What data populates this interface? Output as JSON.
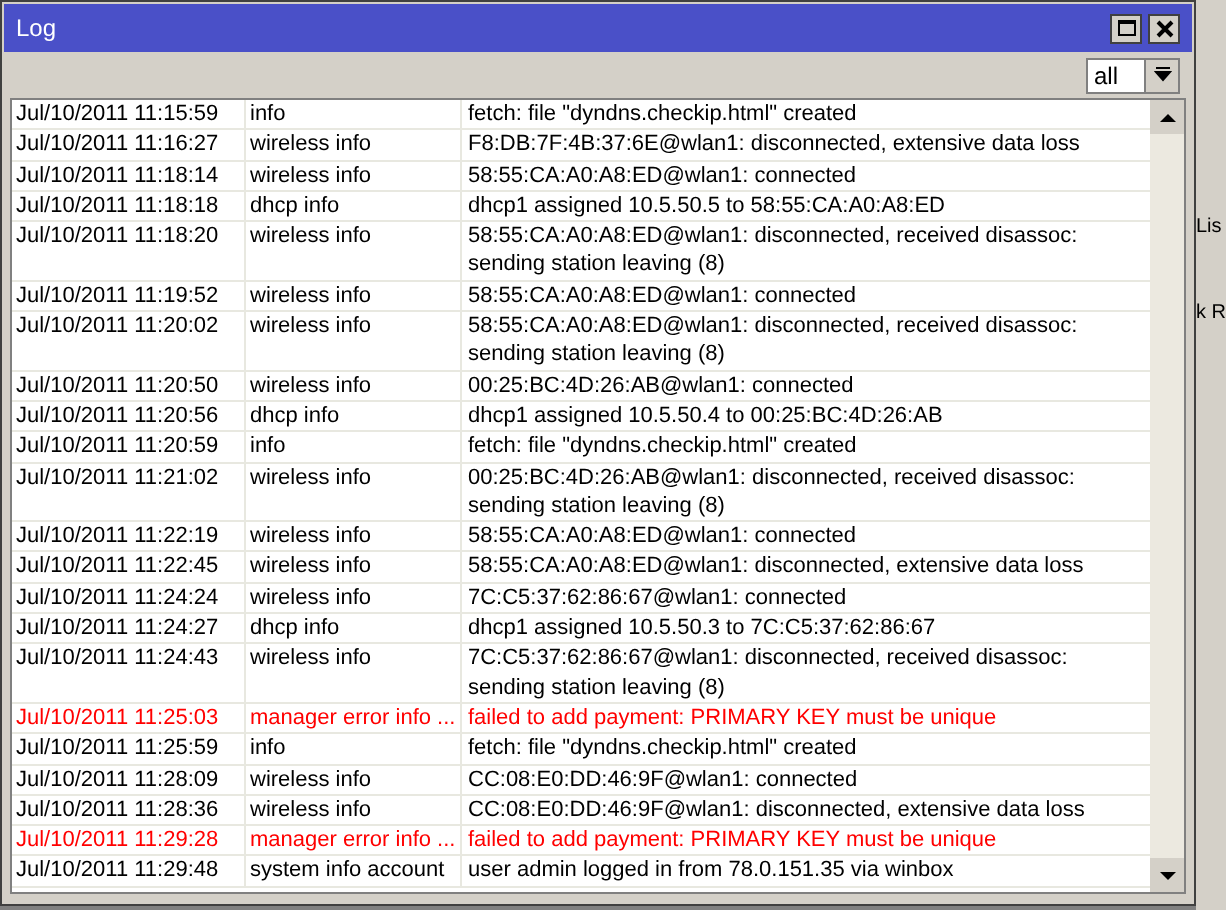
{
  "window": {
    "title": "Log"
  },
  "filter": {
    "value": "all"
  },
  "background_window": {
    "labels": [
      "Lis",
      "k R"
    ]
  },
  "rows": [
    {
      "time": "Jul/10/2011 11:15:59",
      "topics": "info",
      "message": "fetch: file \"dyndns.checkip.html\" created",
      "error": false
    },
    {
      "time": "Jul/10/2011 11:16:27",
      "topics": "wireless info",
      "message": "F8:DB:7F:4B:37:6E@wlan1: disconnected, extensive data loss",
      "error": false
    },
    {
      "time": "Jul/10/2011 11:18:14",
      "topics": "wireless info",
      "message": "58:55:CA:A0:A8:ED@wlan1: connected",
      "error": false
    },
    {
      "time": "Jul/10/2011 11:18:18",
      "topics": "dhcp info",
      "message": "dhcp1 assigned 10.5.50.5 to 58:55:CA:A0:A8:ED",
      "error": false
    },
    {
      "time": "Jul/10/2011 11:18:20",
      "topics": "wireless info",
      "message": "58:55:CA:A0:A8:ED@wlan1: disconnected, received disassoc: sending station leaving (8)",
      "error": false
    },
    {
      "time": "Jul/10/2011 11:19:52",
      "topics": "wireless info",
      "message": "58:55:CA:A0:A8:ED@wlan1: connected",
      "error": false
    },
    {
      "time": "Jul/10/2011 11:20:02",
      "topics": "wireless info",
      "message": "58:55:CA:A0:A8:ED@wlan1: disconnected, received disassoc: sending station leaving (8)",
      "error": false
    },
    {
      "time": "Jul/10/2011 11:20:50",
      "topics": "wireless info",
      "message": "00:25:BC:4D:26:AB@wlan1: connected",
      "error": false
    },
    {
      "time": "Jul/10/2011 11:20:56",
      "topics": "dhcp info",
      "message": "dhcp1 assigned 10.5.50.4 to 00:25:BC:4D:26:AB",
      "error": false
    },
    {
      "time": "Jul/10/2011 11:20:59",
      "topics": "info",
      "message": "fetch: file \"dyndns.checkip.html\" created",
      "error": false
    },
    {
      "time": "Jul/10/2011 11:21:02",
      "topics": "wireless info",
      "message": "00:25:BC:4D:26:AB@wlan1: disconnected, received disassoc: sending station leaving (8)",
      "error": false
    },
    {
      "time": "Jul/10/2011 11:22:19",
      "topics": "wireless info",
      "message": "58:55:CA:A0:A8:ED@wlan1: connected",
      "error": false
    },
    {
      "time": "Jul/10/2011 11:22:45",
      "topics": "wireless info",
      "message": "58:55:CA:A0:A8:ED@wlan1: disconnected, extensive data loss",
      "error": false
    },
    {
      "time": "Jul/10/2011 11:24:24",
      "topics": "wireless info",
      "message": "7C:C5:37:62:86:67@wlan1: connected",
      "error": false
    },
    {
      "time": "Jul/10/2011 11:24:27",
      "topics": "dhcp info",
      "message": "dhcp1 assigned 10.5.50.3 to 7C:C5:37:62:86:67",
      "error": false
    },
    {
      "time": "Jul/10/2011 11:24:43",
      "topics": "wireless info",
      "message": "7C:C5:37:62:86:67@wlan1: disconnected, received disassoc: sending station leaving (8)",
      "error": false
    },
    {
      "time": "Jul/10/2011 11:25:03",
      "topics": "manager error info ...",
      "message": "failed to add payment: PRIMARY KEY must be unique",
      "error": true
    },
    {
      "time": "Jul/10/2011 11:25:59",
      "topics": "info",
      "message": "fetch: file \"dyndns.checkip.html\" created",
      "error": false
    },
    {
      "time": "Jul/10/2011 11:28:09",
      "topics": "wireless info",
      "message": "CC:08:E0:DD:46:9F@wlan1: connected",
      "error": false
    },
    {
      "time": "Jul/10/2011 11:28:36",
      "topics": "wireless info",
      "message": "CC:08:E0:DD:46:9F@wlan1: disconnected, extensive data loss",
      "error": false
    },
    {
      "time": "Jul/10/2011 11:29:28",
      "topics": "manager error info ...",
      "message": "failed to add payment: PRIMARY KEY must be unique",
      "error": true
    },
    {
      "time": "Jul/10/2011 11:29:48",
      "topics": "system info account",
      "message": "user admin logged in from 78.0.151.35 via winbox",
      "error": false
    }
  ]
}
